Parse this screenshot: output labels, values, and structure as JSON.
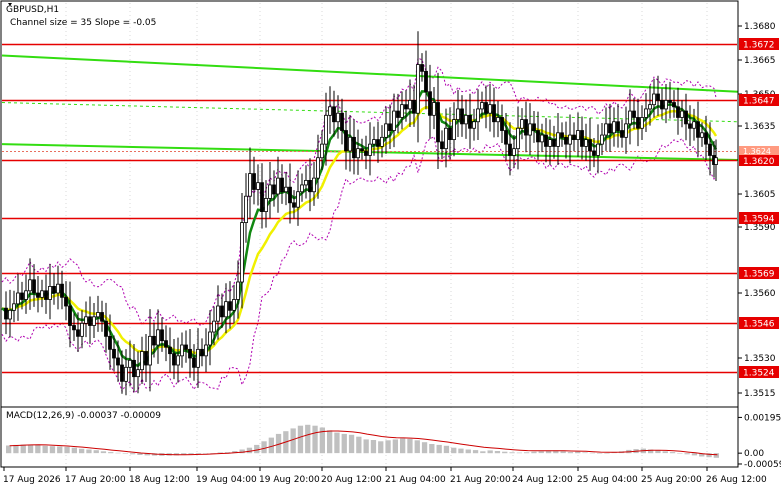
{
  "chart_data": {
    "type": "candlestick",
    "symbol_title": "GBPUSD,H1",
    "indicator_text": "Channel size = 35 Slope = -0.05",
    "price_axis_ticks": [
      "1.3680",
      "1.3665",
      "1.3650",
      "1.3635",
      "1.3605",
      "1.3590",
      "1.3560",
      "1.3530",
      "1.3515"
    ],
    "ylim": [
      1.351,
      1.369
    ],
    "horizontal_levels": [
      {
        "label": "1.3672",
        "value": 1.3672,
        "color": "#e60000"
      },
      {
        "label": "1.3647",
        "value": 1.3647,
        "color": "#e60000"
      },
      {
        "label": "1.3620",
        "value": 1.362,
        "color": "#e60000"
      },
      {
        "label": "1.3594",
        "value": 1.3594,
        "color": "#e60000"
      },
      {
        "label": "1.3569",
        "value": 1.3569,
        "color": "#e60000"
      },
      {
        "label": "1.3546",
        "value": 1.3546,
        "color": "#e60000"
      },
      {
        "label": "1.3524",
        "value": 1.3524,
        "color": "#e60000"
      }
    ],
    "current_price_tag": {
      "label": "1.3624",
      "value": 1.3624
    },
    "time_labels": [
      "17 Aug 2026",
      "17 Aug 20:00",
      "18 Aug 12:00",
      "19 Aug 04:00",
      "19 Aug 20:00",
      "20 Aug 12:00",
      "21 Aug 04:00",
      "21 Aug 20:00",
      "24 Aug 12:00",
      "25 Aug 04:00",
      "25 Aug 20:00",
      "26 Aug 12:00"
    ],
    "time_label_x": [
      4,
      66,
      130,
      197,
      260,
      322,
      386,
      451,
      513,
      578,
      642,
      707
    ],
    "close_path": [
      [
        0,
        1.3553
      ],
      [
        4,
        1.3548
      ],
      [
        8,
        1.3552
      ],
      [
        12,
        1.3555
      ],
      [
        16,
        1.356
      ],
      [
        20,
        1.3557
      ],
      [
        24,
        1.3561
      ],
      [
        28,
        1.3566
      ],
      [
        32,
        1.356
      ],
      [
        36,
        1.3558
      ],
      [
        40,
        1.3561
      ],
      [
        44,
        1.3557
      ],
      [
        48,
        1.3563
      ],
      [
        52,
        1.356
      ],
      [
        56,
        1.3564
      ],
      [
        60,
        1.3558
      ],
      [
        64,
        1.3554
      ],
      [
        68,
        1.3545
      ],
      [
        72,
        1.3543
      ],
      [
        76,
        1.354
      ],
      [
        80,
        1.3546
      ],
      [
        84,
        1.3549
      ],
      [
        88,
        1.3545
      ],
      [
        92,
        1.3549
      ],
      [
        96,
        1.3551
      ],
      [
        100,
        1.3547
      ],
      [
        104,
        1.354
      ],
      [
        108,
        1.3534
      ],
      [
        112,
        1.353
      ],
      [
        116,
        1.3527
      ],
      [
        120,
        1.352
      ],
      [
        124,
        1.3526
      ],
      [
        128,
        1.3529
      ],
      [
        132,
        1.3522
      ],
      [
        136,
        1.3525
      ],
      [
        140,
        1.3533
      ],
      [
        144,
        1.3527
      ],
      [
        148,
        1.354
      ],
      [
        152,
        1.3536
      ],
      [
        156,
        1.3543
      ],
      [
        160,
        1.3538
      ],
      [
        164,
        1.3535
      ],
      [
        168,
        1.3532
      ],
      [
        172,
        1.3527
      ],
      [
        176,
        1.3531
      ],
      [
        180,
        1.3536
      ],
      [
        184,
        1.3534
      ],
      [
        188,
        1.353
      ],
      [
        192,
        1.3526
      ],
      [
        196,
        1.3534
      ],
      [
        200,
        1.3531
      ],
      [
        204,
        1.3536
      ],
      [
        208,
        1.3542
      ],
      [
        212,
        1.3547
      ],
      [
        216,
        1.3554
      ],
      [
        220,
        1.3549
      ],
      [
        224,
        1.3556
      ],
      [
        228,
        1.3552
      ],
      [
        232,
        1.3557
      ],
      [
        236,
        1.3565
      ],
      [
        240,
        1.3592
      ],
      [
        244,
        1.3604
      ],
      [
        248,
        1.3614
      ],
      [
        252,
        1.3607
      ],
      [
        256,
        1.361
      ],
      [
        260,
        1.3597
      ],
      [
        264,
        1.3603
      ],
      [
        268,
        1.3609
      ],
      [
        272,
        1.3605
      ],
      [
        276,
        1.3612
      ],
      [
        280,
        1.3606
      ],
      [
        284,
        1.3608
      ],
      [
        288,
        1.3601
      ],
      [
        292,
        1.3599
      ],
      [
        296,
        1.3606
      ],
      [
        300,
        1.3609
      ],
      [
        304,
        1.3611
      ],
      [
        308,
        1.3606
      ],
      [
        312,
        1.3612
      ],
      [
        316,
        1.3621
      ],
      [
        320,
        1.3627
      ],
      [
        324,
        1.364
      ],
      [
        328,
        1.3644
      ],
      [
        332,
        1.3637
      ],
      [
        336,
        1.3641
      ],
      [
        340,
        1.3633
      ],
      [
        344,
        1.3624
      ],
      [
        348,
        1.363
      ],
      [
        352,
        1.3621
      ],
      [
        356,
        1.3625
      ],
      [
        360,
        1.3624
      ],
      [
        364,
        1.3622
      ],
      [
        368,
        1.3627
      ],
      [
        372,
        1.3629
      ],
      [
        376,
        1.3626
      ],
      [
        380,
        1.363
      ],
      [
        384,
        1.3636
      ],
      [
        388,
        1.3633
      ],
      [
        392,
        1.3642
      ],
      [
        396,
        1.3639
      ],
      [
        400,
        1.3645
      ],
      [
        404,
        1.3643
      ],
      [
        408,
        1.3647
      ],
      [
        412,
        1.3641
      ],
      [
        416,
        1.3663
      ],
      [
        420,
        1.366
      ],
      [
        424,
        1.3651
      ],
      [
        428,
        1.364
      ],
      [
        432,
        1.3646
      ],
      [
        436,
        1.3628
      ],
      [
        440,
        1.3625
      ],
      [
        444,
        1.3634
      ],
      [
        448,
        1.3629
      ],
      [
        452,
        1.3638
      ],
      [
        456,
        1.3643
      ],
      [
        460,
        1.3636
      ],
      [
        464,
        1.364
      ],
      [
        468,
        1.3634
      ],
      [
        472,
        1.3637
      ],
      [
        476,
        1.3643
      ],
      [
        480,
        1.3646
      ],
      [
        484,
        1.3641
      ],
      [
        488,
        1.3645
      ],
      [
        492,
        1.3637
      ],
      [
        496,
        1.3639
      ],
      [
        500,
        1.3633
      ],
      [
        504,
        1.3627
      ],
      [
        508,
        1.3622
      ],
      [
        512,
        1.3625
      ],
      [
        516,
        1.3634
      ],
      [
        520,
        1.3638
      ],
      [
        524,
        1.3631
      ],
      [
        528,
        1.3636
      ],
      [
        532,
        1.3633
      ],
      [
        536,
        1.3628
      ],
      [
        540,
        1.3631
      ],
      [
        544,
        1.3626
      ],
      [
        548,
        1.3629
      ],
      [
        552,
        1.3626
      ],
      [
        556,
        1.3632
      ],
      [
        560,
        1.363
      ],
      [
        564,
        1.3627
      ],
      [
        568,
        1.3631
      ],
      [
        572,
        1.3629
      ],
      [
        576,
        1.3633
      ],
      [
        580,
        1.3626
      ],
      [
        584,
        1.3629
      ],
      [
        588,
        1.3624
      ],
      [
        592,
        1.3622
      ],
      [
        596,
        1.3627
      ],
      [
        600,
        1.3631
      ],
      [
        604,
        1.3636
      ],
      [
        608,
        1.3632
      ],
      [
        612,
        1.3637
      ],
      [
        616,
        1.3633
      ],
      [
        620,
        1.363
      ],
      [
        624,
        1.3636
      ],
      [
        628,
        1.3642
      ],
      [
        632,
        1.3639
      ],
      [
        636,
        1.3634
      ],
      [
        640,
        1.3639
      ],
      [
        644,
        1.3643
      ],
      [
        648,
        1.3645
      ],
      [
        652,
        1.365
      ],
      [
        656,
        1.3647
      ],
      [
        660,
        1.3643
      ],
      [
        664,
        1.3647
      ],
      [
        668,
        1.3646
      ],
      [
        672,
        1.3644
      ],
      [
        676,
        1.3639
      ],
      [
        680,
        1.3642
      ],
      [
        684,
        1.3636
      ],
      [
        688,
        1.3634
      ],
      [
        692,
        1.3637
      ],
      [
        696,
        1.363
      ],
      [
        700,
        1.3632
      ],
      [
        704,
        1.3627
      ],
      [
        708,
        1.3622
      ],
      [
        712,
        1.3618
      ],
      [
        714,
        1.3621
      ]
    ],
    "macd": {
      "title": "MACD(12,26,9) -0.00037 -0.00009",
      "axis_ticks": [
        "0.00195",
        "0.00",
        "-0.00059"
      ],
      "ylim": [
        -0.0007,
        0.0023
      ],
      "histogram": [
        0.00042,
        0.00045,
        0.00047,
        0.00046,
        0.00044,
        0.0004,
        0.00038,
        0.00037,
        0.00035,
        0.0003,
        0.00024,
        0.0002,
        0.00016,
        0.0001,
        6e-05,
        2e-05,
        -2e-05,
        -6e-05,
        -0.0001,
        -0.00012,
        -0.00013,
        -0.00014,
        -0.00013,
        -0.00012,
        -9e-05,
        -6e-05,
        -4e-05,
        -2e-05,
        0.0,
        4e-05,
        6e-05,
        0.00012,
        0.0002,
        0.0003,
        0.00045,
        0.00065,
        0.00085,
        0.00105,
        0.0012,
        0.00135,
        0.0015,
        0.00155,
        0.0015,
        0.0014,
        0.00125,
        0.00112,
        0.00105,
        0.001,
        0.0009,
        0.00075,
        0.00072,
        0.00065,
        0.0007,
        0.00075,
        0.0008,
        0.00078,
        0.0007,
        0.0006,
        0.0005,
        0.00045,
        0.0004,
        0.0003,
        0.00025,
        0.0002,
        0.00017,
        0.0001,
        0.00015,
        0.00012,
        8e-05,
        5e-05,
        3e-05,
        5e-05,
        8e-05,
        0.0001,
        0.00012,
        0.00015,
        0.0001,
        6e-05,
        8e-05,
        4e-05,
        2e-05,
        0.0,
        -2e-05,
        4e-05,
        0.0001,
        0.00018,
        0.00022,
        0.00025,
        0.0002,
        0.00016,
        0.0001,
        6e-05,
        0.0,
        -6e-05,
        -0.00012,
        -0.00018,
        -0.00022,
        -0.00025
      ],
      "signal": [
        0.0004,
        0.00042,
        0.00044,
        0.00045,
        0.00046,
        0.00045,
        0.00043,
        0.00041,
        0.00039,
        0.00036,
        0.00033,
        0.00029,
        0.00025,
        0.00021,
        0.00017,
        0.00013,
        9e-05,
        5e-05,
        1e-05,
        -2e-05,
        -5e-05,
        -7e-05,
        -8e-05,
        -9e-05,
        -9e-05,
        -8e-05,
        -7e-05,
        -6e-05,
        -4e-05,
        -2e-05,
        0.0,
        3e-05,
        6e-05,
        0.00011,
        0.00018,
        0.00027,
        0.00038,
        0.0005,
        0.00063,
        0.00076,
        0.0009,
        0.00102,
        0.00112,
        0.00118,
        0.00121,
        0.00121,
        0.00119,
        0.00116,
        0.00111,
        0.00104,
        0.00098,
        0.00091,
        0.00087,
        0.00084,
        0.00083,
        0.00082,
        0.0008,
        0.00076,
        0.00071,
        0.00066,
        0.00061,
        0.00055,
        0.00049,
        0.00043,
        0.00038,
        0.00032,
        0.00029,
        0.00026,
        0.00022,
        0.00019,
        0.00016,
        0.00014,
        0.00013,
        0.00013,
        0.00013,
        0.00013,
        0.00013,
        0.00012,
        0.00011,
        0.0001,
        8e-05,
        6e-05,
        5e-05,
        5e-05,
        6e-05,
        8e-05,
        0.00011,
        0.00014,
        0.00016,
        0.00016,
        0.00015,
        0.00013,
        0.0001,
        6e-05,
        2e-05,
        -3e-05,
        -7e-05,
        -9e-05
      ]
    },
    "colors": {
      "levels": "#e60000",
      "tag_bg": "#e60000",
      "ma_fast": "#118811",
      "ma_slow": "#f0f000",
      "channel": "#33dd11",
      "bands": "#b000b0",
      "candles": "#000000",
      "macd_hist": "#c0c0c0",
      "macd_signal": "#cc0000"
    }
  }
}
